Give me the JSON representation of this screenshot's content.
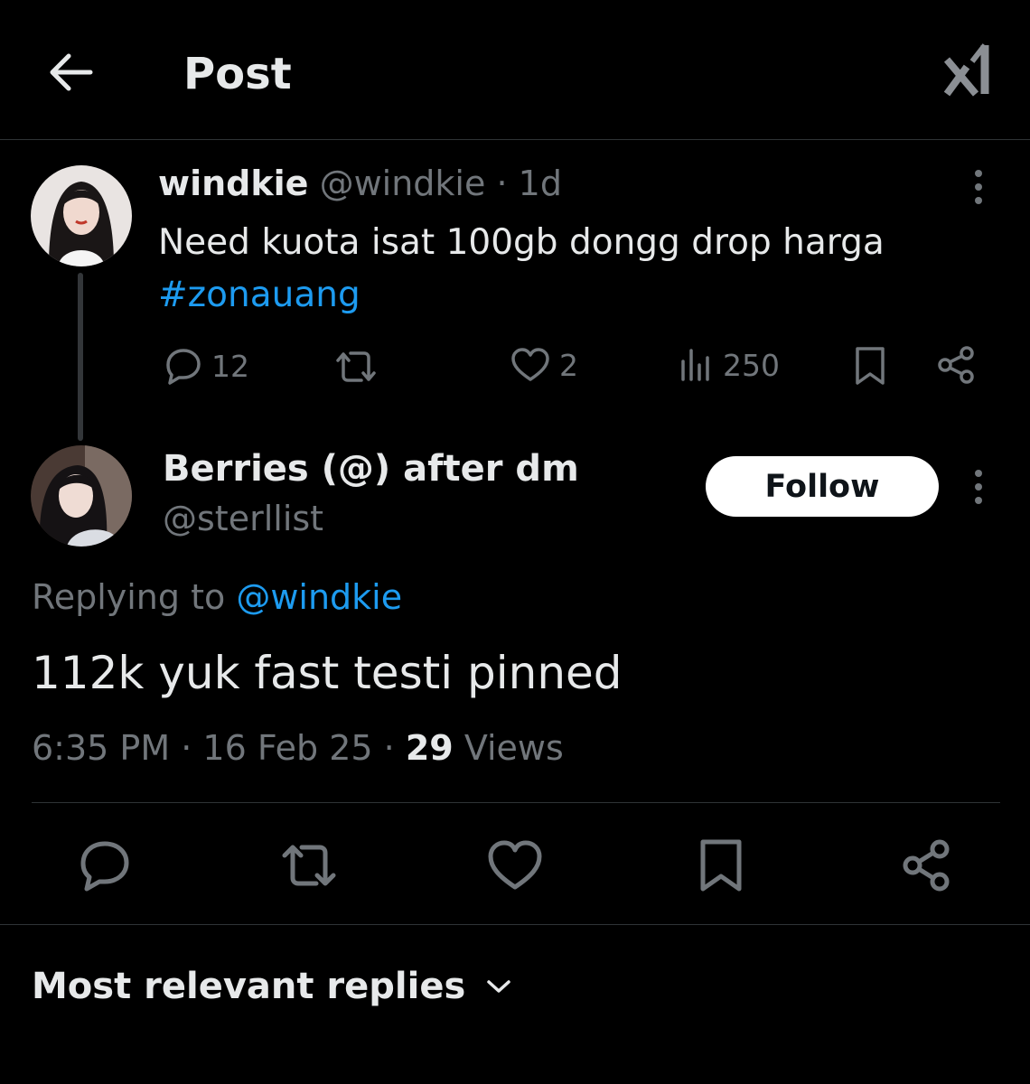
{
  "header": {
    "title": "Post"
  },
  "parent_post": {
    "display_name": "windkie",
    "handle": "@windkie",
    "separator": "·",
    "age": "1d",
    "text": "Need kuota isat 100gb dongg drop harga",
    "hashtag": "#zonauang",
    "stats": {
      "replies": "12",
      "likes": "2",
      "views": "250"
    }
  },
  "reply_post": {
    "display_name": "Berries (@) after dm",
    "handle": "@sterllist",
    "follow_label": "Follow",
    "replying_prefix": "Replying to",
    "replying_handle": "@windkie",
    "text": "112k yuk fast testi pinned",
    "time": "6:35 PM",
    "date": "16 Feb 25",
    "view_count": "29",
    "views_label": "Views",
    "separator": "·"
  },
  "replies_sort": {
    "label": "Most relevant replies"
  },
  "colors": {
    "background": "#000000",
    "text": "#e7e9ea",
    "muted": "#71767b",
    "link": "#1d9bf0",
    "divider": "#2f3336"
  },
  "icons": {
    "back": "arrow-left-icon",
    "grok": "grok-icon",
    "more": "more-vertical-icon",
    "reply": "reply-bubble-icon",
    "repost": "repost-icon",
    "like": "heart-icon",
    "views": "views-bar-icon",
    "bookmark": "bookmark-icon",
    "share": "share-icon",
    "chevron": "chevron-down-icon"
  }
}
